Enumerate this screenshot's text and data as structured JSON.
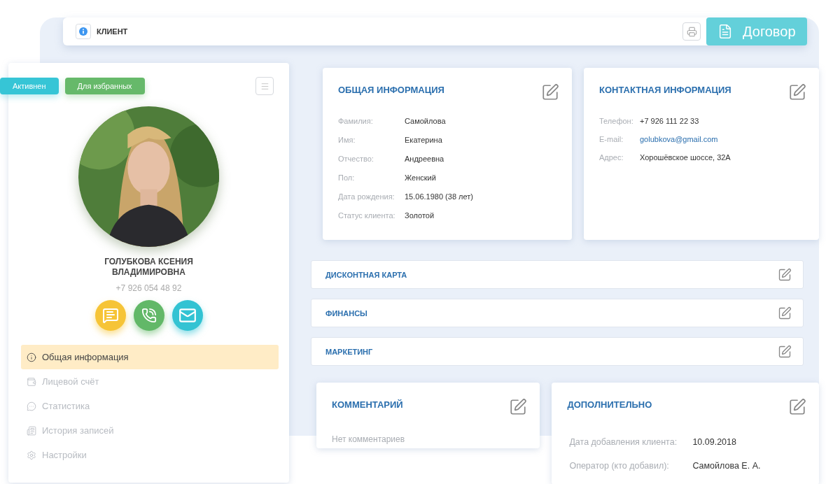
{
  "topbar": {
    "title": "КЛИЕНТ",
    "contract_button": "Договор"
  },
  "profile": {
    "tags": [
      {
        "label": "Активнен",
        "color": "#36c5d6"
      },
      {
        "label": "Для избранных",
        "color": "#66b96a"
      }
    ],
    "name_lines": [
      "ГОЛУБКОВА КСЕНИЯ",
      "ВЛАДИМИРОВНА"
    ],
    "phone": "+7 926 054 48 92",
    "actions": [
      {
        "kind": "sms",
        "color": "#f6c437"
      },
      {
        "kind": "call",
        "color": "#62b868"
      },
      {
        "kind": "email",
        "color": "#33c3d3"
      }
    ],
    "nav": [
      {
        "label": "Общая информация",
        "selected": true
      },
      {
        "label": "Лицевой счёт",
        "selected": false
      },
      {
        "label": "Статистика",
        "selected": false
      },
      {
        "label": "История записей",
        "selected": false
      },
      {
        "label": "Настройки",
        "selected": false
      }
    ]
  },
  "general": {
    "title": "ОБЩАЯ ИНФОРМАЦИЯ",
    "fields": [
      {
        "label": "Фамилия:",
        "value": "Самойлова"
      },
      {
        "label": "Имя:",
        "value": "Екатерина"
      },
      {
        "label": "Отчество:",
        "value": "Андреевна"
      },
      {
        "label": "Пол:",
        "value": "Женский"
      },
      {
        "label": "Дата рождения:",
        "value": "15.06.1980 (38 лет)"
      },
      {
        "label": "Статус клиента:",
        "value": "Золотой"
      }
    ]
  },
  "contact": {
    "title": "КОНТАКТНАЯ ИНФОРМАЦИЯ",
    "fields": [
      {
        "label": "Телефон:",
        "value": "+7 926 111 22 33",
        "kind": "text"
      },
      {
        "label": "E-mail:",
        "value": "golubkova@gmail.com",
        "kind": "link"
      },
      {
        "label": "Адрес:",
        "value": "Хорошёвское шоссе, 32А",
        "kind": "text"
      }
    ]
  },
  "sections": [
    {
      "title": "ДИСКОНТНАЯ КАРТА"
    },
    {
      "title": "ФИНАНСЫ"
    },
    {
      "title": "МАРКЕТИНГ"
    }
  ],
  "comment": {
    "title": "КОММЕНТАРИЙ",
    "text": "Нет комментариев"
  },
  "extra": {
    "title": "ДОПОЛНИТЕЛЬНО",
    "fields": [
      {
        "label": "Дата добавления клиента:",
        "value": "10.09.2018"
      },
      {
        "label": "Оператор (кто добавил):",
        "value": "Самойлова Е. А."
      }
    ]
  }
}
